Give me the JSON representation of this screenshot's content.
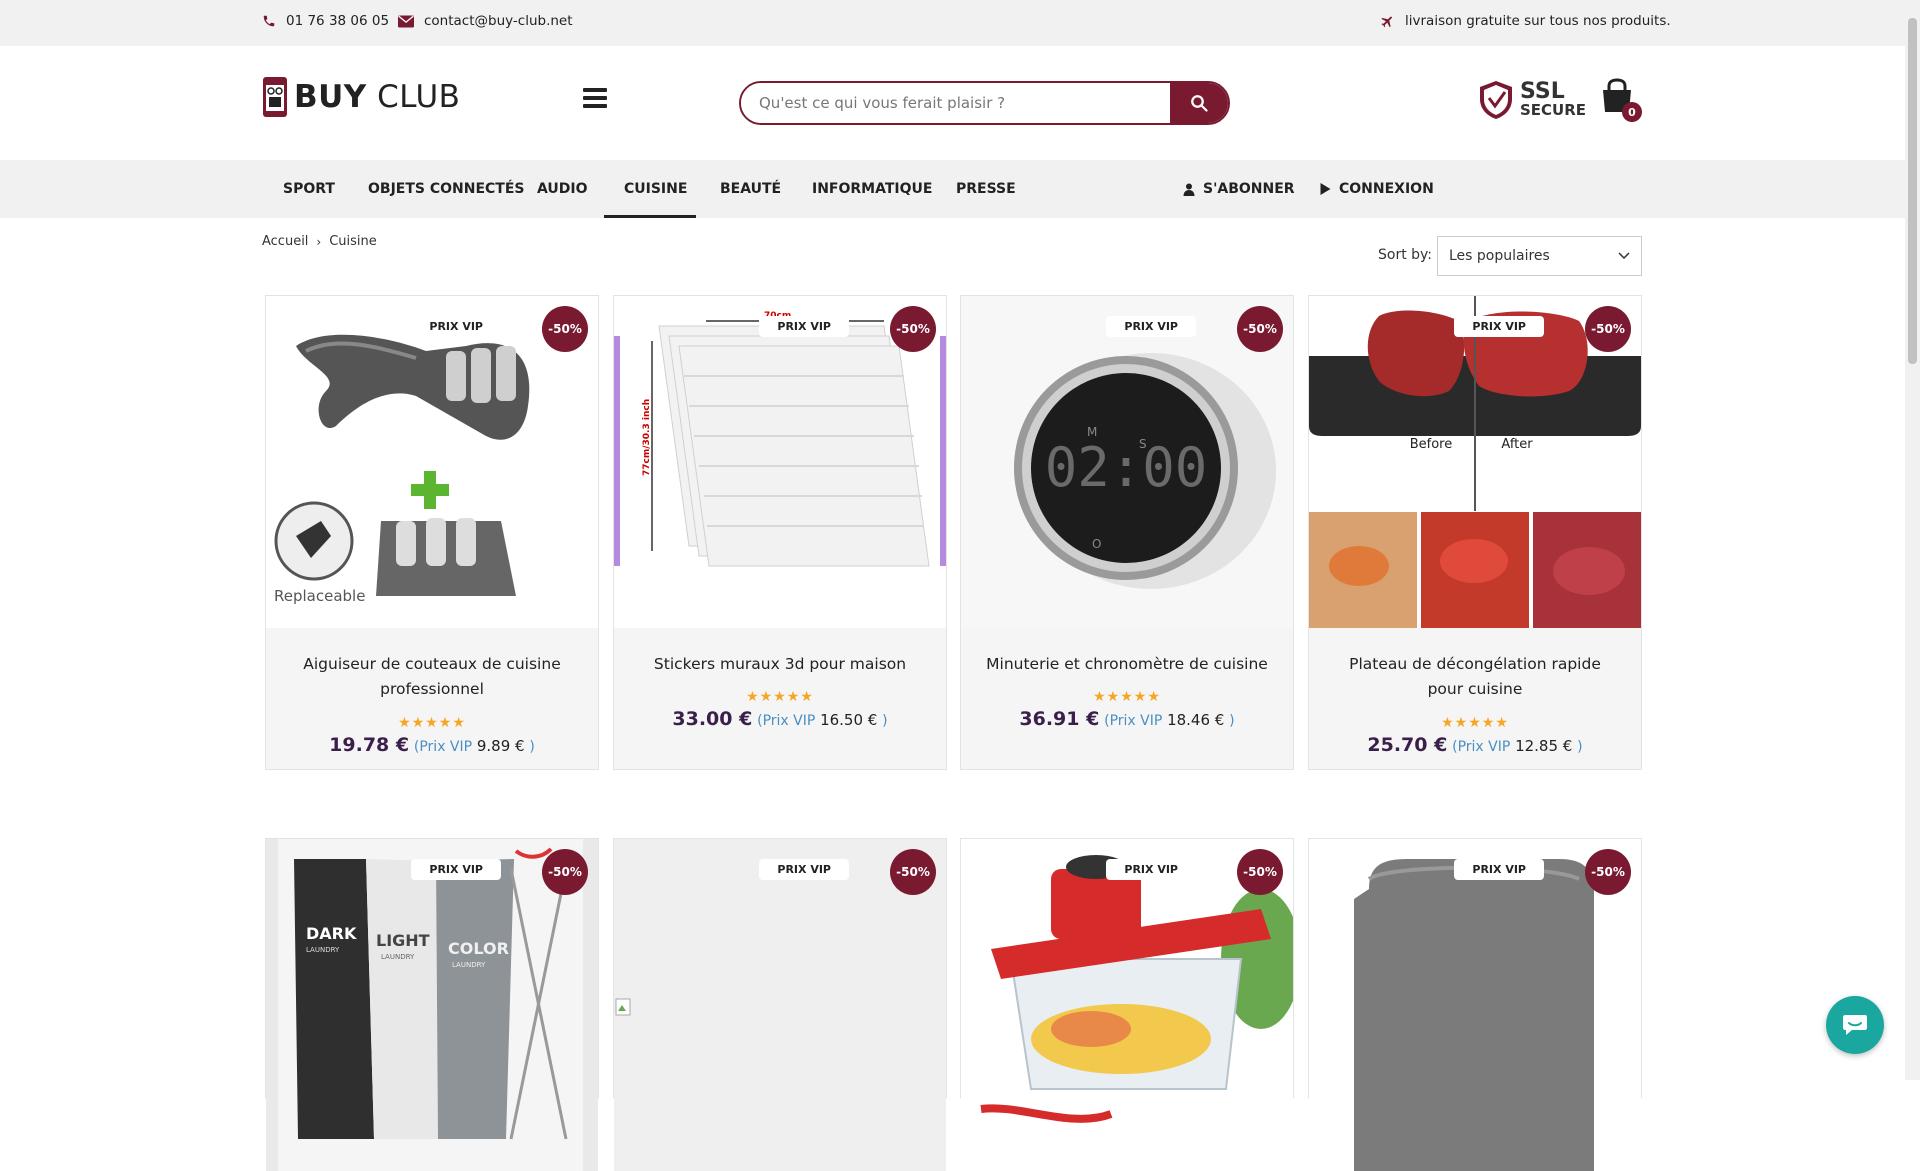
{
  "topbar": {
    "phone": "01 76 38 06 05",
    "email": "contact@buy-club.net",
    "shipping": "livraison gratuite sur tous nos produits."
  },
  "header": {
    "logo_bold": "BUY",
    "logo_light": "CLUB",
    "search_placeholder": "Qu'est ce qui vous ferait plaisir ?",
    "ssl_line1": "SSL",
    "ssl_line2": "SECURE",
    "cart_count": "0"
  },
  "nav": {
    "items": [
      "SPORT",
      "OBJETS CONNECTÉS",
      "AUDIO",
      "CUISINE",
      "BEAUTÉ",
      "INFORMATIQUE",
      "PRESSE"
    ],
    "active": "CUISINE",
    "subscribe": "S'ABONNER",
    "login": "CONNEXION"
  },
  "breadcrumb": {
    "home": "Accueil",
    "current": "Cuisine"
  },
  "sort": {
    "label": "Sort by:",
    "value": "Les populaires"
  },
  "products": [
    {
      "title": "Aiguiseur de couteaux de cuisine professionnel",
      "vip_badge": "PRIX VIP",
      "discount": "-50%",
      "stars": "★★★★★",
      "price": "19.78 €",
      "vip_label": "(Prix VIP",
      "vip_price": "9.89 €",
      "vip_close": ")"
    },
    {
      "title": "Stickers muraux 3d pour maison",
      "vip_badge": "PRIX VIP",
      "discount": "-50%",
      "stars": "★★★★★",
      "price": "33.00 €",
      "vip_label": "(Prix VIP",
      "vip_price": "16.50 €",
      "vip_close": ")"
    },
    {
      "title": "Minuterie et chronomètre de cuisine",
      "vip_badge": "PRIX VIP",
      "discount": "-50%",
      "stars": "★★★★★",
      "price": "36.91 €",
      "vip_label": "(Prix VIP",
      "vip_price": "18.46 €",
      "vip_close": ")"
    },
    {
      "title": "Plateau de décongélation rapide pour cuisine",
      "vip_badge": "PRIX VIP",
      "discount": "-50%",
      "stars": "★★★★★",
      "price": "25.70 €",
      "vip_label": "(Prix VIP",
      "vip_price": "12.85 €",
      "vip_close": ")"
    },
    {
      "vip_badge": "PRIX VIP",
      "discount": "-50%"
    },
    {
      "vip_badge": "PRIX VIP",
      "discount": "-50%"
    },
    {
      "vip_badge": "PRIX VIP",
      "discount": "-50%"
    },
    {
      "vip_badge": "PRIX VIP",
      "discount": "-50%"
    }
  ],
  "product_images": {
    "sharpener_label": "Replaceable",
    "timer_display": "02:00",
    "tray_before": "Before",
    "tray_after": "After",
    "wall_dim": "70cm",
    "wall_dim_v": "77cm/30.3 inch",
    "hamper_l1": "DARK",
    "hamper_l2": "LIGHT",
    "hamper_l3": "COLOR",
    "hamper_sub": "LAUNDRY"
  },
  "colors": {
    "brand": "#7a1a30",
    "vip_text": "#4a8fc2",
    "price": "#3a1f4a",
    "star": "#f5a623",
    "chat": "#19a7a0"
  }
}
